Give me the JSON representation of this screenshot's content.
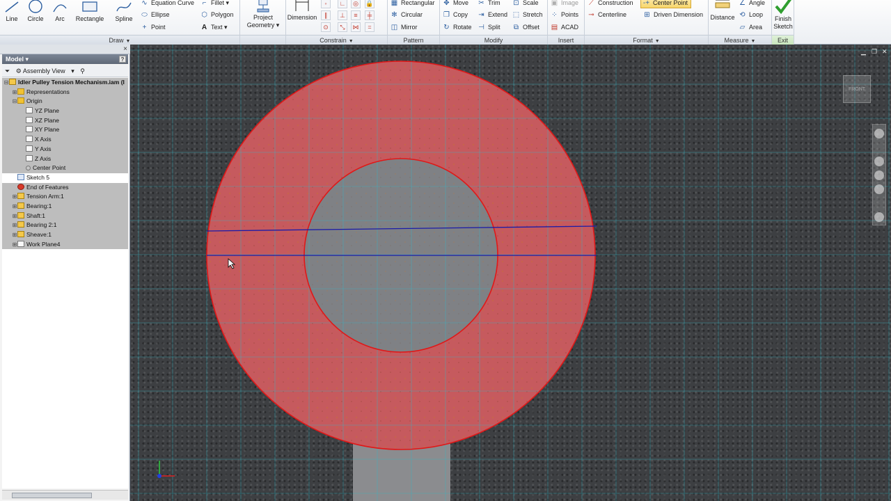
{
  "ribbon": {
    "draw": {
      "title": "Draw",
      "big": {
        "line": "Line",
        "circle": "Circle",
        "arc": "Arc",
        "rectangle": "Rectangle",
        "spline": "Spline"
      },
      "small": {
        "equation_curve": "Equation Curve",
        "ellipse": "Ellipse",
        "point": "Point",
        "fillet": "Fillet",
        "polygon": "Polygon",
        "text": "Text"
      },
      "project_geometry": "Project Geometry"
    },
    "constrain": {
      "title": "Constrain",
      "dimension": "Dimension"
    },
    "pattern": {
      "title": "Pattern",
      "items": [
        "Rectangular",
        "Circular",
        "Mirror"
      ]
    },
    "modify": {
      "title": "Modify",
      "col1": [
        "Move",
        "Copy",
        "Rotate"
      ],
      "col2": [
        "Trim",
        "Extend",
        "Split"
      ],
      "col3": [
        "Scale",
        "Stretch",
        "Offset"
      ]
    },
    "insert": {
      "title": "Insert",
      "items": [
        "Image",
        "Points",
        "ACAD"
      ]
    },
    "format": {
      "title": "Format",
      "construction": "Construction",
      "center_point": "Center Point",
      "centerline": "Centerline",
      "driven_dimension": "Driven Dimension"
    },
    "measure": {
      "title": "Measure",
      "distance": "Distance",
      "items": [
        "Angle",
        "Loop",
        "Area"
      ]
    },
    "exit": {
      "title": "Exit",
      "finish_sketch": "Finish Sketch"
    }
  },
  "browser": {
    "tab": "Model",
    "help": "?",
    "view": "Assembly View",
    "tree": [
      {
        "label": "Idler Pulley Tension Mechanism.iam (I",
        "indent": 0,
        "icon": "asm",
        "exp": "-"
      },
      {
        "label": "Representations",
        "indent": 1,
        "icon": "folder",
        "exp": "+"
      },
      {
        "label": "Origin",
        "indent": 1,
        "icon": "folder",
        "exp": "-"
      },
      {
        "label": "YZ Plane",
        "indent": 2,
        "icon": "plane",
        "exp": ""
      },
      {
        "label": "XZ Plane",
        "indent": 2,
        "icon": "plane",
        "exp": ""
      },
      {
        "label": "XY Plane",
        "indent": 2,
        "icon": "plane",
        "exp": ""
      },
      {
        "label": "X Axis",
        "indent": 2,
        "icon": "plane",
        "exp": ""
      },
      {
        "label": "Y Axis",
        "indent": 2,
        "icon": "plane",
        "exp": ""
      },
      {
        "label": "Z Axis",
        "indent": 2,
        "icon": "plane",
        "exp": ""
      },
      {
        "label": "Center Point",
        "indent": 2,
        "icon": "point",
        "exp": ""
      },
      {
        "label": "Sketch 5",
        "indent": 1,
        "icon": "sketch",
        "exp": "",
        "selected": true
      },
      {
        "label": "End of Features",
        "indent": 1,
        "icon": "stop",
        "exp": ""
      },
      {
        "label": "Tension Arm:1",
        "indent": 1,
        "icon": "asm",
        "exp": "+"
      },
      {
        "label": "Bearing:1",
        "indent": 1,
        "icon": "asm",
        "exp": "+"
      },
      {
        "label": "Shaft:1",
        "indent": 1,
        "icon": "asm",
        "exp": "+"
      },
      {
        "label": "Bearing 2:1",
        "indent": 1,
        "icon": "asm",
        "exp": "+"
      },
      {
        "label": "Sheave:1",
        "indent": 1,
        "icon": "asm",
        "exp": "+"
      },
      {
        "label": "Work Plane4",
        "indent": 1,
        "icon": "plane",
        "exp": "+"
      }
    ]
  },
  "viewport": {
    "viewcube": "FRONT"
  },
  "colors": {
    "ring_fill": "#c65a5e",
    "ring_stroke": "#e01818",
    "grid": "#39b6c4",
    "sketch_line": "#1b1ba8"
  }
}
